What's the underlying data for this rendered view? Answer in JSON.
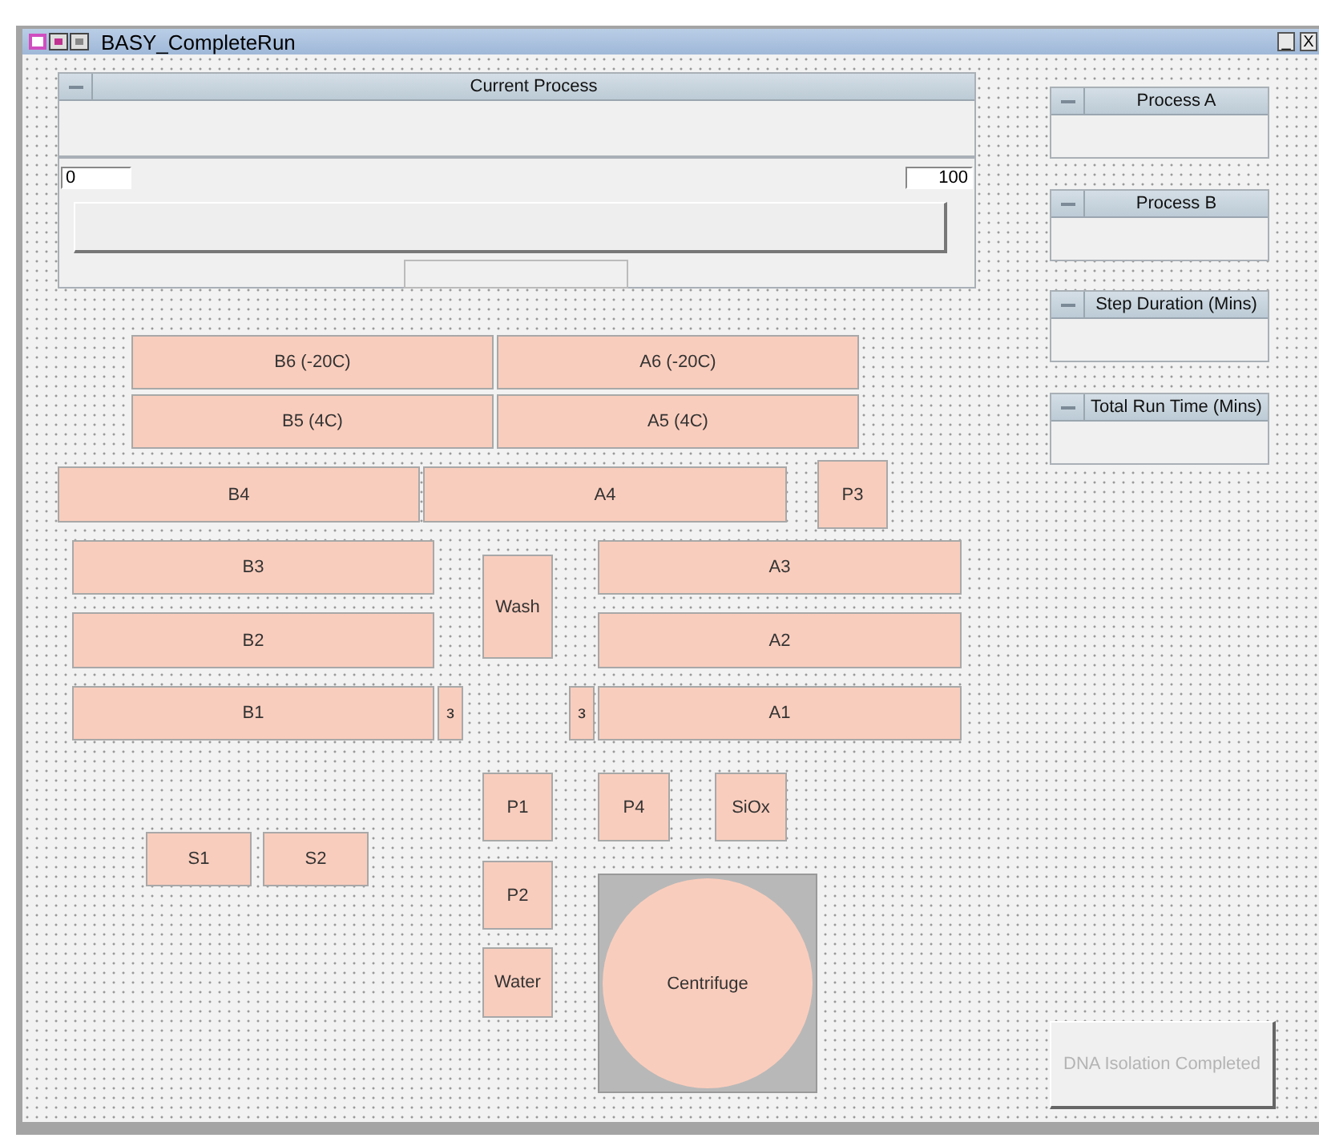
{
  "window": {
    "title": "BASY_CompleteRun",
    "controls": [
      "_",
      "X"
    ]
  },
  "current_process": {
    "title": "Current Process",
    "min": "0",
    "max": "100",
    "level": 0
  },
  "side_panels": [
    {
      "title": "Process A"
    },
    {
      "title": "Process B"
    },
    {
      "title": "Step Duration (Mins)"
    },
    {
      "title": "Total Run Time (Mins)"
    }
  ],
  "stations": [
    {
      "label": "B6 (-20C)",
      "kind": "button"
    },
    {
      "label": "A6 (-20C)",
      "kind": "button"
    },
    {
      "label": "B5 (4C)",
      "kind": "button"
    },
    {
      "label": "A5 (4C)",
      "kind": "button"
    },
    {
      "label": "B4",
      "kind": "button"
    },
    {
      "label": "A4",
      "kind": "button"
    },
    {
      "label": "P3",
      "kind": "button"
    },
    {
      "label": "B3",
      "kind": "button"
    },
    {
      "label": "Wash",
      "kind": "button"
    },
    {
      "label": "A3",
      "kind": "button"
    },
    {
      "label": "B2",
      "kind": "button"
    },
    {
      "label": "A2",
      "kind": "button"
    },
    {
      "label": "B1",
      "kind": "button"
    },
    {
      "label": "з",
      "kind": "button"
    },
    {
      "label": "з",
      "kind": "button"
    },
    {
      "label": "A1",
      "kind": "button"
    },
    {
      "label": "P1",
      "kind": "button"
    },
    {
      "label": "P4",
      "kind": "button"
    },
    {
      "label": "SiOx",
      "kind": "button"
    },
    {
      "label": "S1",
      "kind": "button"
    },
    {
      "label": "S2",
      "kind": "button"
    },
    {
      "label": "P2",
      "kind": "button"
    },
    {
      "label": "Water",
      "kind": "button"
    },
    {
      "label": "Centrifuge",
      "kind": "rotor"
    }
  ],
  "status_button": {
    "label": "DNA Isolation Completed",
    "disabled": true
  }
}
